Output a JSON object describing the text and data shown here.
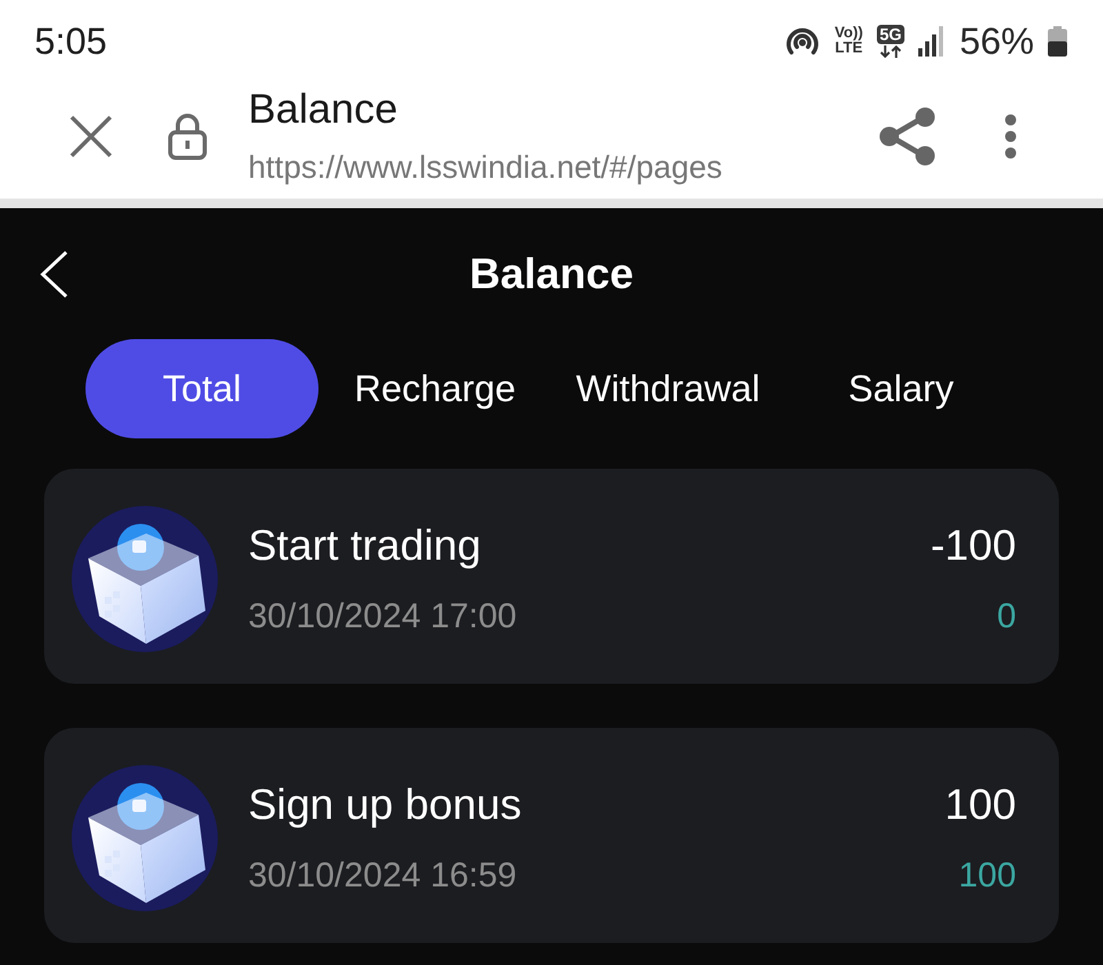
{
  "status_bar": {
    "time": "5:05",
    "volte": "Vo)) LTE",
    "network_type": "5G",
    "battery": "56%"
  },
  "browser_bar": {
    "title": "Balance",
    "url": "https://www.lsswindia.net/#/pages"
  },
  "header": {
    "title": "Balance"
  },
  "tabs": [
    {
      "label": "Total",
      "selected": true
    },
    {
      "label": "Recharge",
      "selected": false
    },
    {
      "label": "Withdrawal",
      "selected": false
    },
    {
      "label": "Salary",
      "selected": false
    }
  ],
  "transactions": [
    {
      "title": "Start trading",
      "date": "30/10/2024 17:00",
      "amount": "-100",
      "balance": "0"
    },
    {
      "title": "Sign up bonus",
      "date": "30/10/2024 16:59",
      "amount": "100",
      "balance": "100"
    }
  ]
}
